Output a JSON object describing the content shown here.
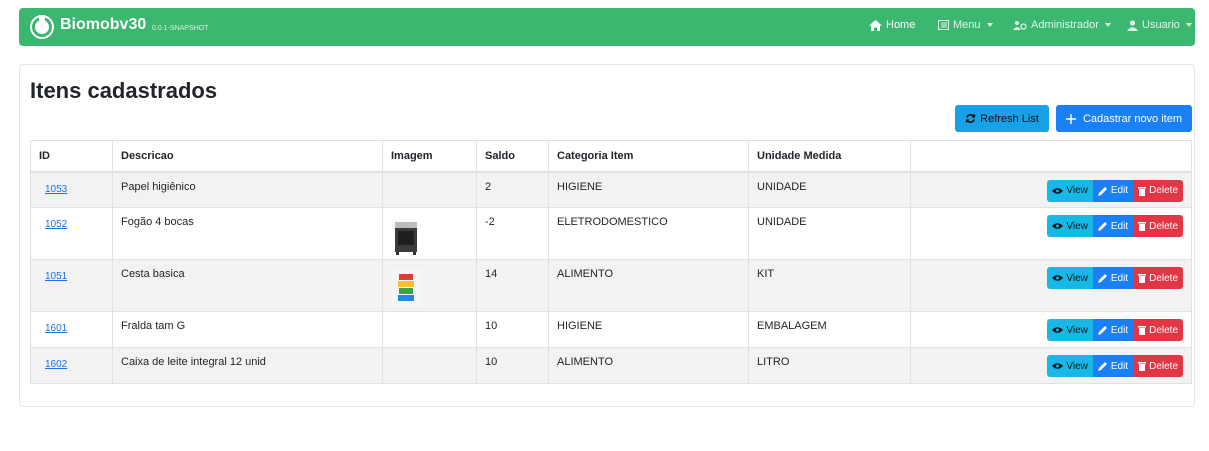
{
  "navbar": {
    "brand": "Biomobv30",
    "version": "0.0.1-SNAPSHOT",
    "home": "Home",
    "menu": "Menu",
    "admin": "Administrador",
    "user": "Usuario",
    "color": "#3cb770"
  },
  "page": {
    "title": "Itens cadastrados",
    "refresh_label": "Refresh List",
    "new_label": "Cadastrar novo item"
  },
  "table": {
    "headers": [
      "ID",
      "Descricao",
      "Imagem",
      "Saldo",
      "Categoria Item",
      "Unidade Medida"
    ],
    "rows": [
      {
        "id": "1053",
        "descricao": "Papel higiênico",
        "imagem": "",
        "saldo": "2",
        "categoria": "HIGIENE",
        "unidade": "UNIDADE"
      },
      {
        "id": "1052",
        "descricao": "Fogão 4 bocas",
        "imagem": "stove-image",
        "saldo": "-2",
        "categoria": "ELETRODOMESTICO",
        "unidade": "UNIDADE"
      },
      {
        "id": "1051",
        "descricao": "Cesta basica",
        "imagem": "basket-image",
        "saldo": "14",
        "categoria": "ALIMENTO",
        "unidade": "KIT"
      },
      {
        "id": "1601",
        "descricao": "Fralda tam G",
        "imagem": "",
        "saldo": "10",
        "categoria": "HIGIENE",
        "unidade": "EMBALAGEM"
      },
      {
        "id": "1602",
        "descricao": "Caixa de leite integral 12 unid",
        "imagem": "",
        "saldo": "10",
        "categoria": "ALIMENTO",
        "unidade": "LITRO"
      }
    ],
    "view_label": "View",
    "edit_label": "Edit",
    "delete_label": "Delete"
  }
}
